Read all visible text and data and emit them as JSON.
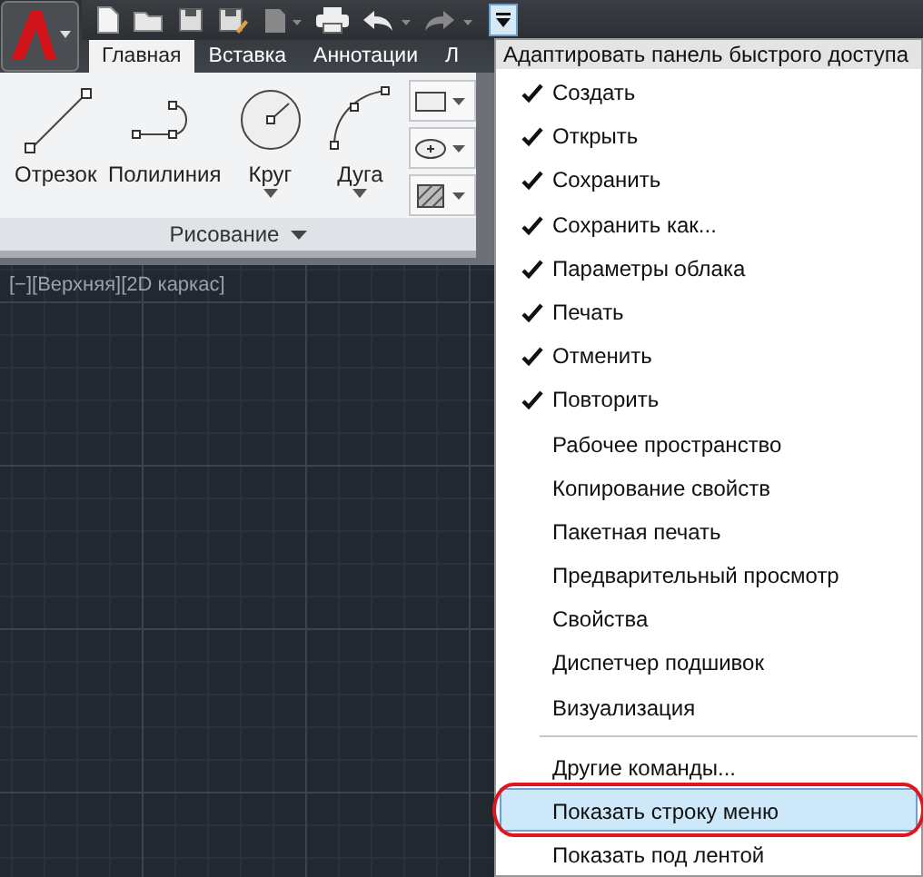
{
  "tabs": [
    {
      "label": "Главная",
      "selected": true
    },
    {
      "label": "Вставка",
      "selected": false
    },
    {
      "label": "Аннотации",
      "selected": false
    },
    {
      "label": "Л",
      "selected": false
    }
  ],
  "ribbon": {
    "tools": [
      {
        "kind": "line",
        "label": "Отрезок",
        "dropdown": false
      },
      {
        "kind": "polyline",
        "label": "Полилиния",
        "dropdown": false
      },
      {
        "kind": "circle",
        "label": "Круг",
        "dropdown": true
      },
      {
        "kind": "arc",
        "label": "Дуга",
        "dropdown": true
      }
    ],
    "panel_title": "Рисование"
  },
  "viewport": {
    "label": "[−][Верхняя][2D каркас]"
  },
  "menu": {
    "title": "Адаптировать панель быстрого доступа",
    "items": [
      {
        "kind": "item",
        "label": "Создать",
        "checked": true,
        "selected": false,
        "circled": false
      },
      {
        "kind": "item",
        "label": "Открыть",
        "checked": true,
        "selected": false,
        "circled": false
      },
      {
        "kind": "item",
        "label": "Сохранить",
        "checked": true,
        "selected": false,
        "circled": false
      },
      {
        "kind": "item",
        "label": "Сохранить как...",
        "checked": true,
        "selected": false,
        "circled": false
      },
      {
        "kind": "item",
        "label": "Параметры облака",
        "checked": true,
        "selected": false,
        "circled": false
      },
      {
        "kind": "item",
        "label": "Печать",
        "checked": true,
        "selected": false,
        "circled": false
      },
      {
        "kind": "item",
        "label": "Отменить",
        "checked": true,
        "selected": false,
        "circled": false
      },
      {
        "kind": "item",
        "label": "Повторить",
        "checked": true,
        "selected": false,
        "circled": false
      },
      {
        "kind": "item",
        "label": "Рабочее пространство",
        "checked": false,
        "selected": false,
        "circled": false
      },
      {
        "kind": "item",
        "label": "Копирование свойств",
        "checked": false,
        "selected": false,
        "circled": false
      },
      {
        "kind": "item",
        "label": "Пакетная печать",
        "checked": false,
        "selected": false,
        "circled": false
      },
      {
        "kind": "item",
        "label": "Предварительный просмотр",
        "checked": false,
        "selected": false,
        "circled": false
      },
      {
        "kind": "item",
        "label": "Свойства",
        "checked": false,
        "selected": false,
        "circled": false
      },
      {
        "kind": "item",
        "label": "Диспетчер подшивок",
        "checked": false,
        "selected": false,
        "circled": false
      },
      {
        "kind": "item",
        "label": "Визуализация",
        "checked": false,
        "selected": false,
        "circled": false
      },
      {
        "kind": "separator"
      },
      {
        "kind": "item",
        "label": "Другие команды...",
        "checked": false,
        "selected": false,
        "circled": false
      },
      {
        "kind": "item",
        "label": "Показать строку меню",
        "checked": false,
        "selected": true,
        "circled": true
      },
      {
        "kind": "item",
        "label": "Показать под лентой",
        "checked": false,
        "selected": false,
        "circled": false
      }
    ]
  }
}
